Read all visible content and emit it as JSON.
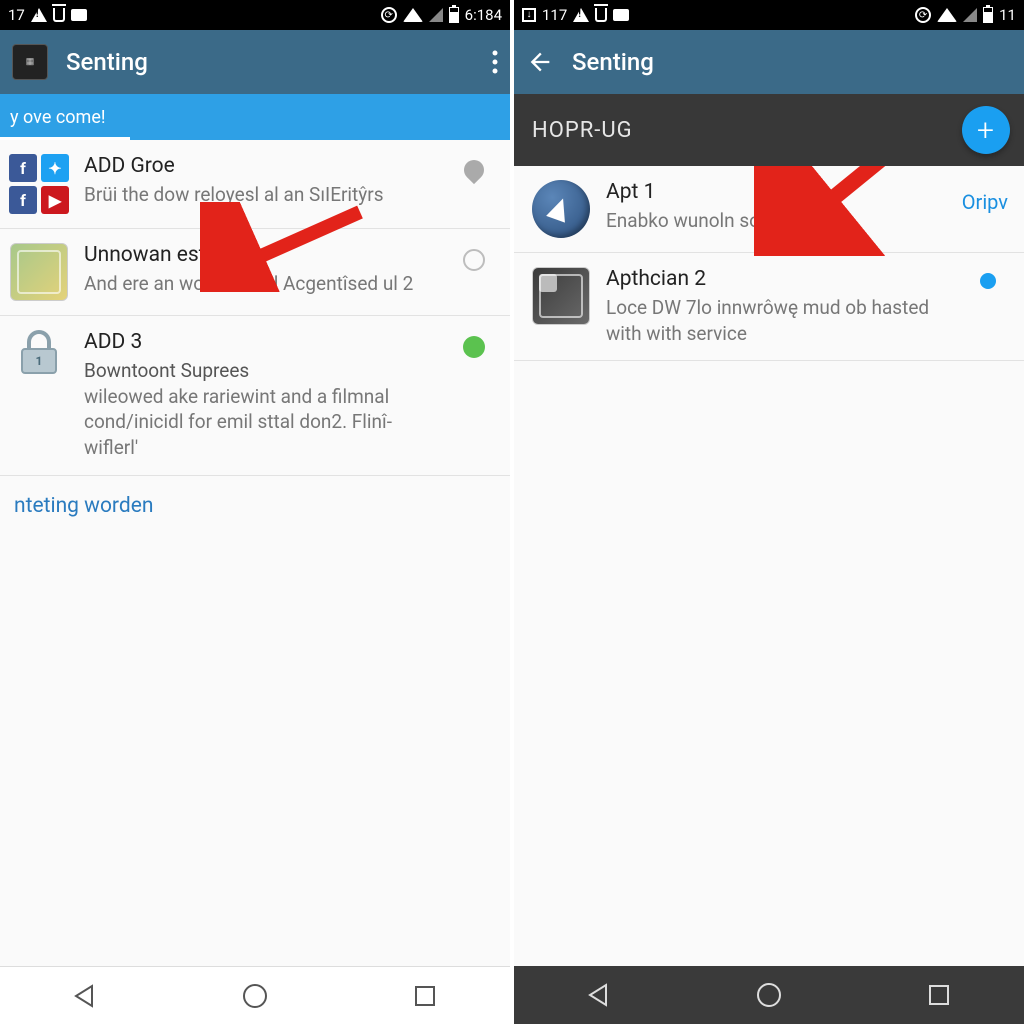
{
  "left": {
    "status": {
      "left_text": "17",
      "time": "6:184"
    },
    "actionbar": {
      "title": "Senting"
    },
    "ribbon": {
      "text": "y ovе come!"
    },
    "rows": [
      {
        "title": "ADD Groe",
        "sub": "Brüі the dow reloyesl al an SıIEritŷrs"
      },
      {
        "title": "Unnowan esto",
        "sub": "And ere an workohe fol Acgentîsed ul 2"
      },
      {
        "title": "ADD 3",
        "sub": "Bowntoont Suprees",
        "sub2": "wileowed ake rarіewint and a filmnal cond/inіcidl for emіl sttal don2. Flinî-wiflerl'"
      }
    ],
    "link": "nteting worden"
  },
  "right": {
    "status": {
      "left_text": "117",
      "time": "11"
    },
    "actionbar": {
      "title": "Senting"
    },
    "section": {
      "header": "HOPR-UG"
    },
    "rows": [
      {
        "title": "Apt 1",
        "sub": "Enabko wunoln sources",
        "action": "Oripv"
      },
      {
        "title": "Apthcian 2",
        "sub": "Loce DW 7lo innwrôwę mud ob hasted with with service"
      }
    ]
  }
}
